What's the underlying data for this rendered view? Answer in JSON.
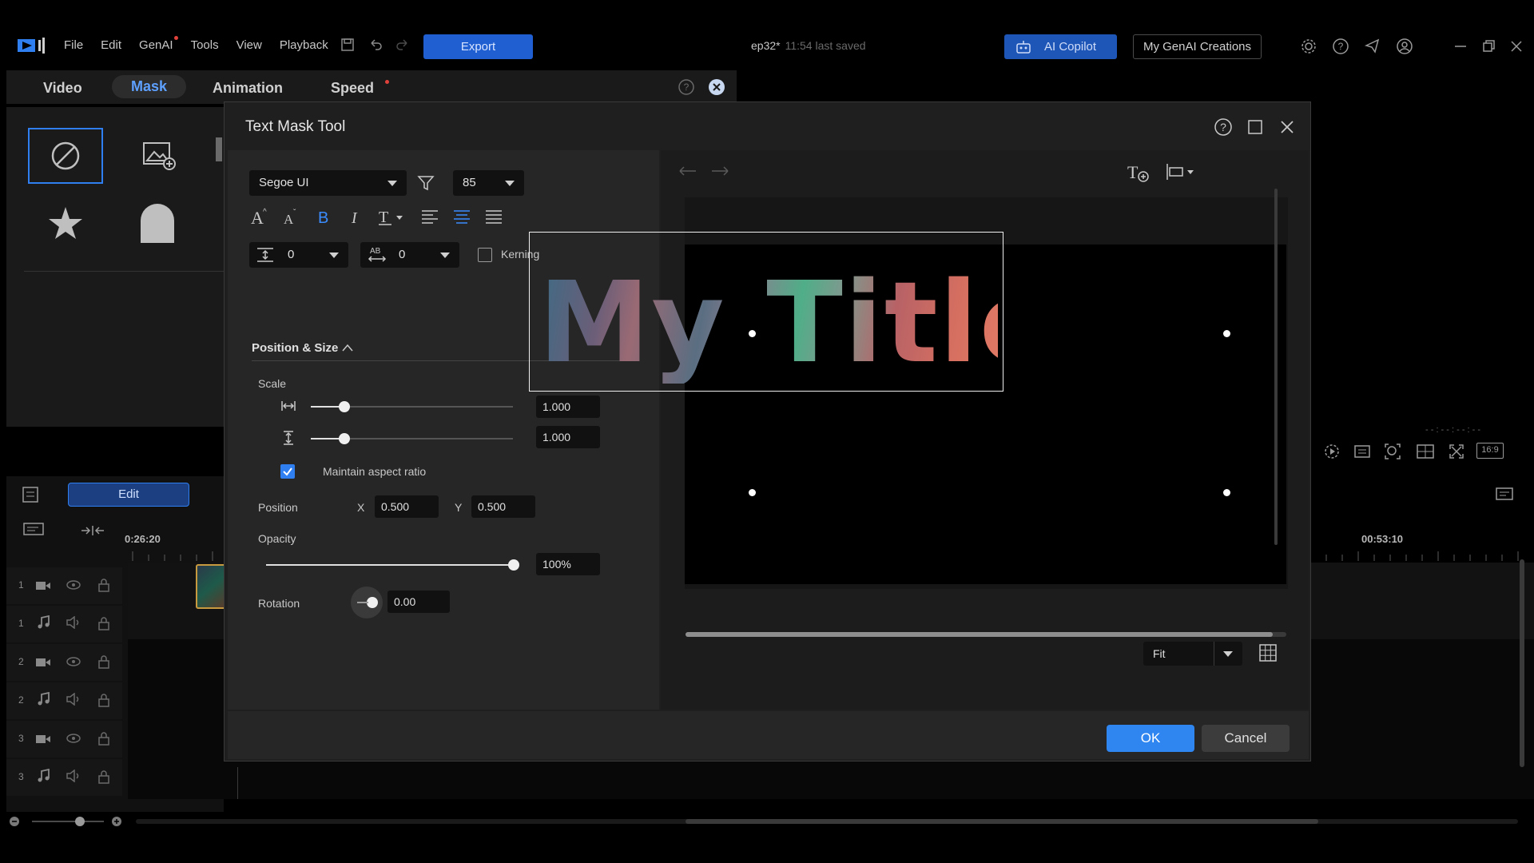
{
  "menu": {
    "items": [
      "File",
      "Edit",
      "GenAI",
      "Tools",
      "View",
      "Playback"
    ],
    "export_label": "Export"
  },
  "project": {
    "name": "ep32*",
    "saved_text": "11:54 last saved"
  },
  "header": {
    "copilot_label": "AI Copilot",
    "genai_label": "My GenAI Creations"
  },
  "editor_tabs": {
    "video": "Video",
    "mask": "Mask",
    "animation": "Animation",
    "speed": "Speed"
  },
  "left_panel": {
    "edit_label": "Edit"
  },
  "timeline": {
    "start_time": "0:26:20",
    "end_time": "00:53:10",
    "tracks": [
      {
        "num": "1",
        "type": "video-icon"
      },
      {
        "num": "1",
        "type": "audio-icon"
      },
      {
        "num": "2",
        "type": "video-icon"
      },
      {
        "num": "2",
        "type": "audio-icon"
      },
      {
        "num": "3",
        "type": "video-icon"
      },
      {
        "num": "3",
        "type": "audio-icon"
      }
    ]
  },
  "preview_bar": {
    "aspect_label": "16:9"
  },
  "dialog": {
    "title": "Text Mask Tool",
    "font": "Segoe UI",
    "font_size": "85",
    "line_spacing": "0",
    "char_spacing": "0",
    "kerning_label": "Kerning",
    "section_title": "Position & Size",
    "scale_label": "Scale",
    "scale_width": "1.000",
    "scale_height": "1.000",
    "maintain_label": "Maintain aspect ratio",
    "position_label": "Position",
    "x_label": "X",
    "x_value": "0.500",
    "y_label": "Y",
    "y_value": "0.500",
    "opacity_label": "Opacity",
    "opacity_value": "100%",
    "rotation_label": "Rotation",
    "rotation_value": "0.00",
    "preview_text": "My Title",
    "zoom_value": "Fit",
    "ok_label": "OK",
    "cancel_label": "Cancel"
  },
  "colors": {
    "accent": "#2f86f0",
    "dialog_bg": "#1f1f1f",
    "panel_bg": "#262626"
  }
}
